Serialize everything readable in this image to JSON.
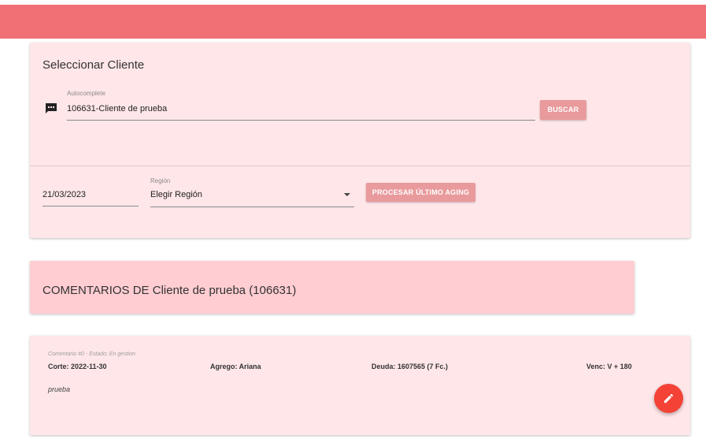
{
  "select_client": {
    "title": "Seleccionar Cliente",
    "autocomplete_label": "Autocomplete",
    "autocomplete_value": "106631-Cliente de prueba",
    "search_button": "BUSCAR",
    "date_value": "21/03/2023",
    "region_label": "Región",
    "region_value": "Elegir Región",
    "process_button": "PROCESAR ÚLTIMO AGING"
  },
  "comments_header": {
    "title": "COMENTARIOS DE Cliente de prueba (106631)"
  },
  "comment": {
    "meta": "Comentario #0 - Estado: En gestion",
    "corte": "Corte: 2022-11-30",
    "agrego": "Agrego: Ariana",
    "deuda": "Deuda: 1607565 (7 Fc.)",
    "venc": "Venc: V + 180",
    "text": "prueba"
  },
  "icons": {
    "autocomplete": "comment-icon",
    "region": "caret-down-icon",
    "fab": "pencil-icon"
  },
  "colors": {
    "header": "#f07075",
    "card": "#ffe6e9",
    "comments_header": "#ffcdd2",
    "button": "#e99a9c",
    "fab": "#f44336"
  }
}
